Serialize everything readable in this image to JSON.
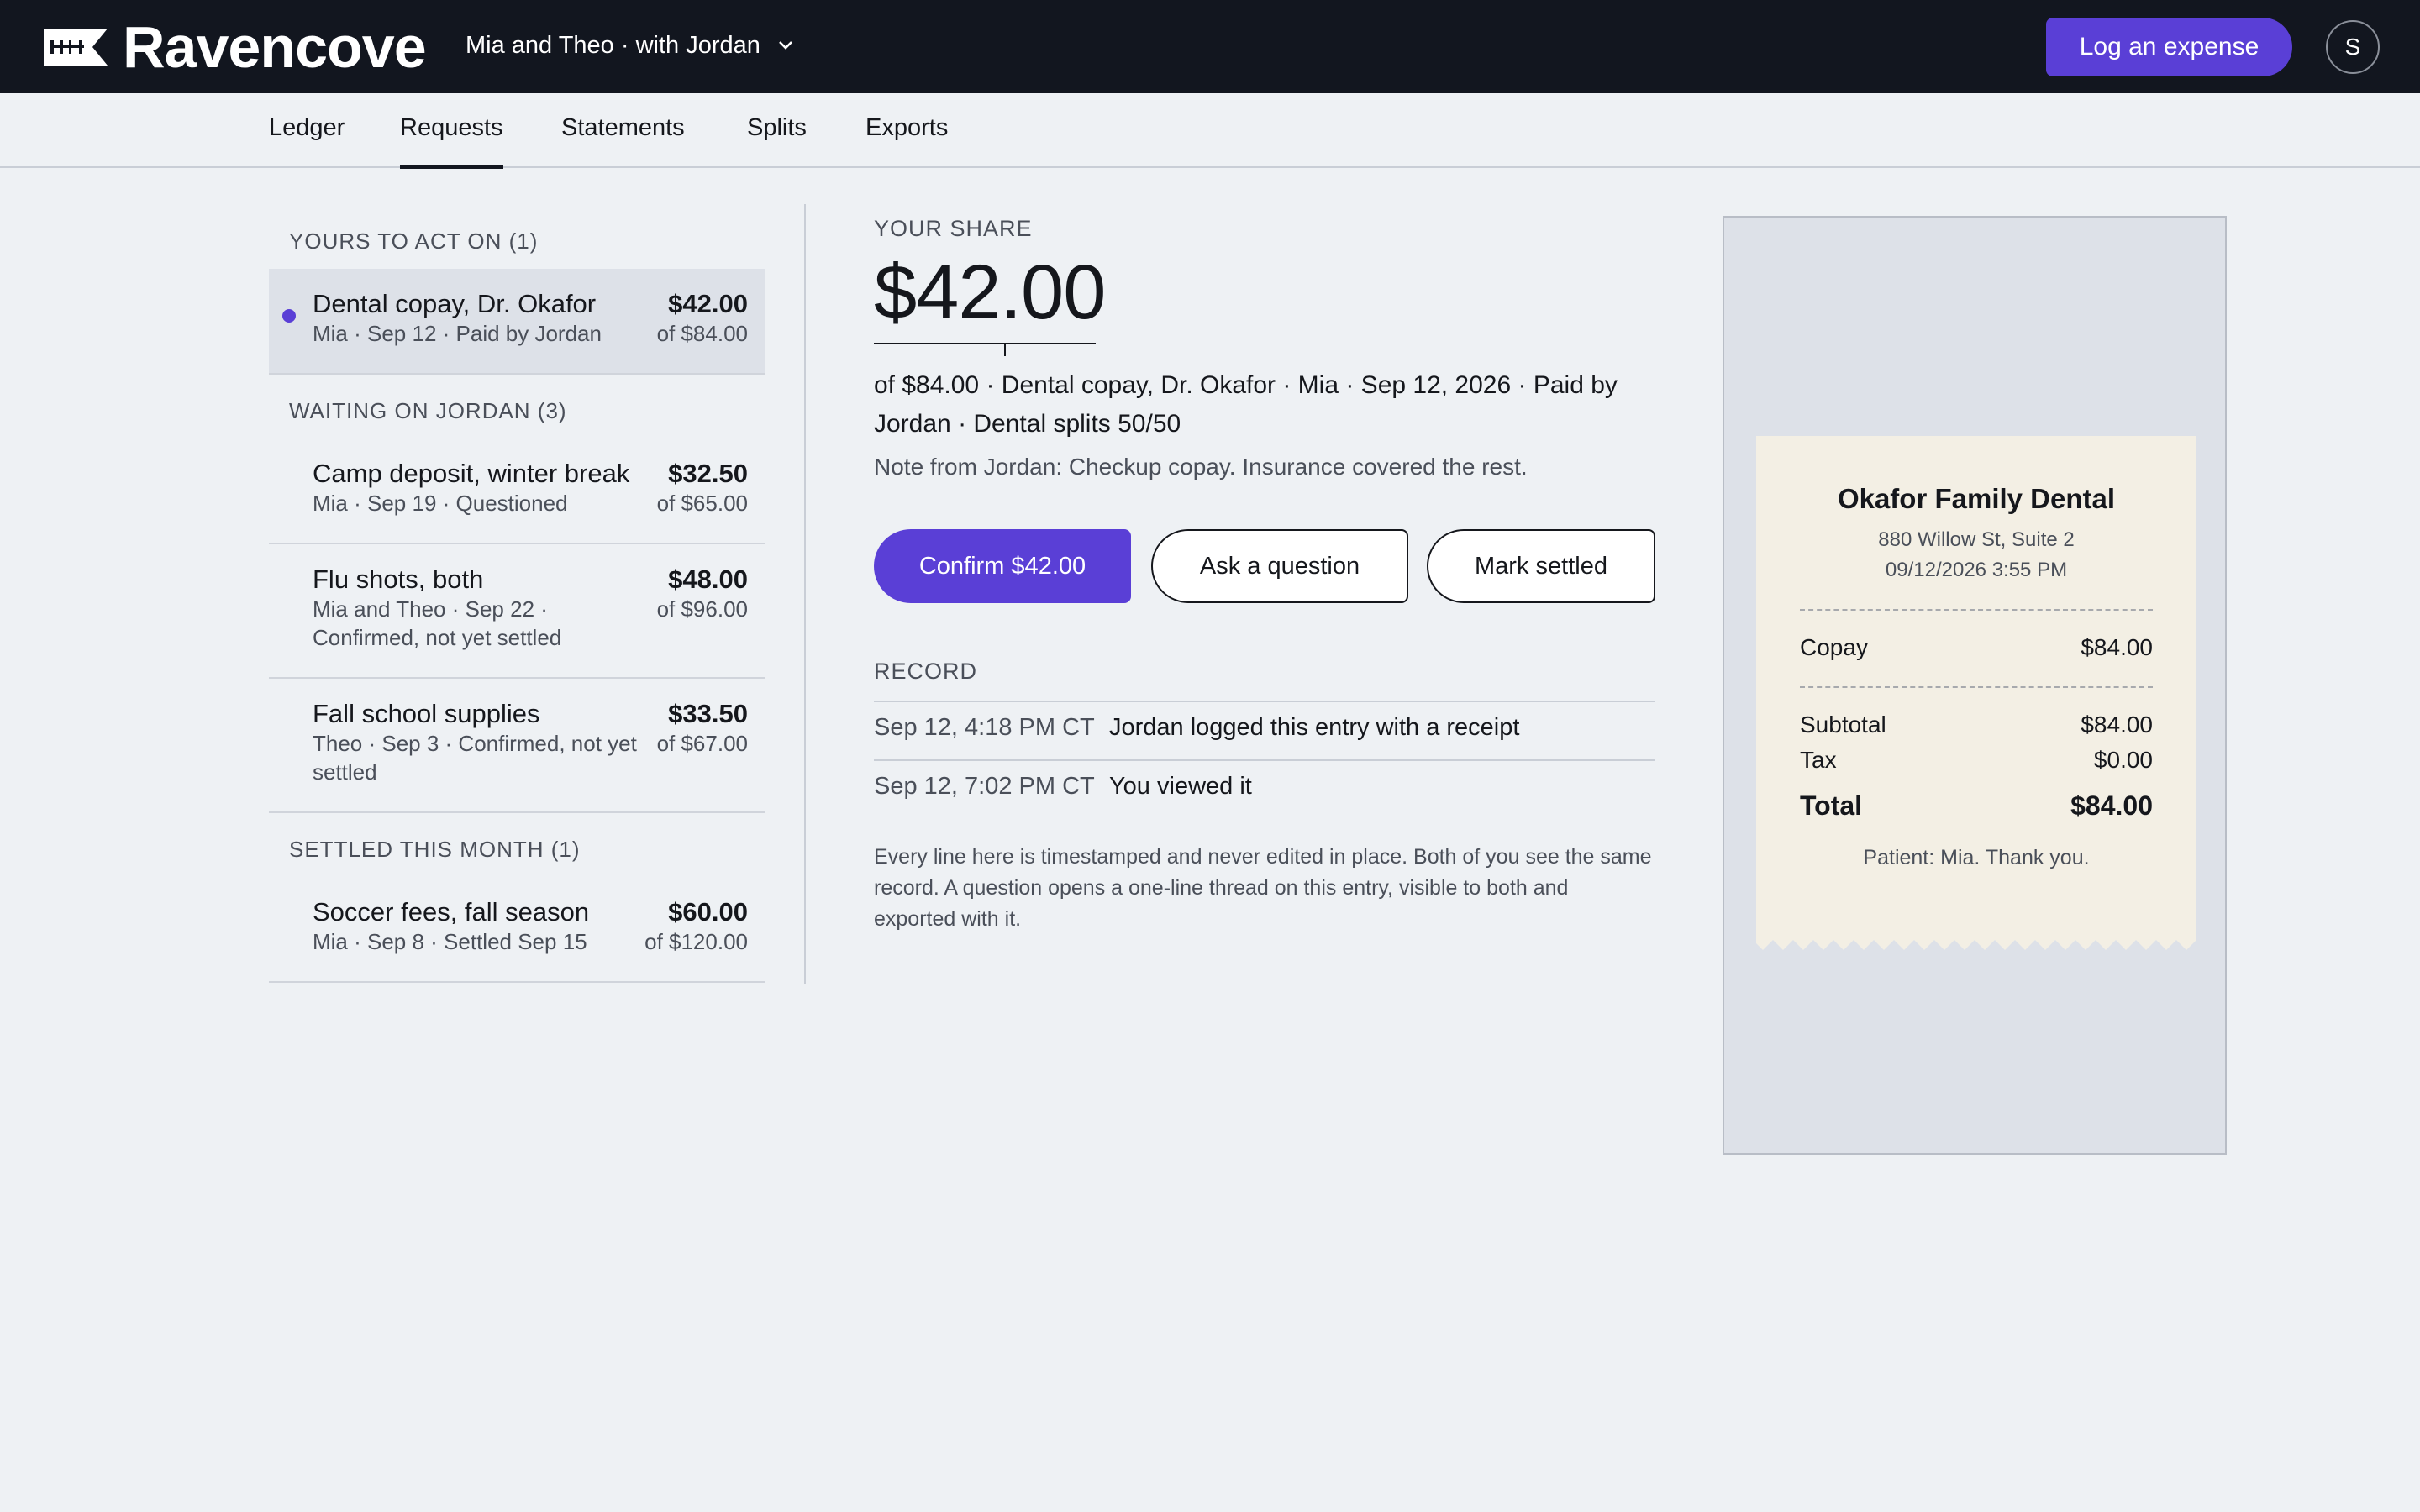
{
  "app": {
    "name": "Ravencove",
    "context": "Mia and Theo · with Jordan",
    "log_button": "Log an expense",
    "avatar_initial": "S"
  },
  "tabs": [
    "Ledger",
    "Requests",
    "Statements",
    "Splits",
    "Exports"
  ],
  "active_tab": "Requests",
  "sections": {
    "yours": "YOURS TO ACT ON (1)",
    "waiting": "WAITING ON JORDAN (3)",
    "settled": "SETTLED THIS MONTH (1)"
  },
  "items": [
    {
      "title": "Dental copay, Dr. Okafor",
      "sub": "Mia · Sep 12 · Paid by Jordan",
      "amount": "$42.00",
      "of": "of $84.00",
      "unread": true
    },
    {
      "title": "Camp deposit, winter break",
      "sub": "Mia · Sep 19 · Questioned",
      "amount": "$32.50",
      "of": "of $65.00"
    },
    {
      "title": "Flu shots, both",
      "sub": "Mia and Theo · Sep 22 · Confirmed, not yet settled",
      "amount": "$48.00",
      "of": "of $96.00"
    },
    {
      "title": "Fall school supplies",
      "sub": "Theo · Sep 3 · Confirmed, not yet settled",
      "amount": "$33.50",
      "of": "of $67.00"
    },
    {
      "title": "Soccer fees, fall season",
      "sub": "Mia · Sep 8 · Settled Sep 15",
      "amount": "$60.00",
      "of": "of $120.00"
    }
  ],
  "detail": {
    "share_label": "YOUR SHARE",
    "share_amount": "$42.00",
    "meta": "of $84.00 · Dental copay, Dr. Okafor · Mia · Sep 12, 2026 · Paid by Jordan · Dental splits 50/50",
    "note": "Note from Jordan: Checkup copay. Insurance covered the rest.",
    "confirm": "Confirm $42.00",
    "ask": "Ask a question",
    "settle": "Mark settled",
    "record_label": "RECORD",
    "record": [
      {
        "time": "Sep 12, 4:18 PM CT",
        "text": "Jordan logged this entry with a receipt"
      },
      {
        "time": "Sep 12, 7:02 PM CT",
        "text": "You viewed it"
      }
    ],
    "footnote": "Every line here is timestamped and never edited in place. Both of you see the same record. A question opens a one-line thread on this entry, visible to both and exported with it."
  },
  "receipt": {
    "merchant": "Okafor Family Dental",
    "address": "880 Willow St, Suite 2",
    "datetime": "09/12/2026 3:55 PM",
    "lines": [
      {
        "label": "Copay",
        "value": "$84.00"
      }
    ],
    "subtotal_label": "Subtotal",
    "subtotal": "$84.00",
    "tax_label": "Tax",
    "tax": "$0.00",
    "total_label": "Total",
    "total": "$84.00",
    "footer": "Patient: Mia. Thank you."
  },
  "colors": {
    "accent": "#5a3fd6",
    "topbar": "#12161f",
    "paper": "#f3efe4"
  }
}
